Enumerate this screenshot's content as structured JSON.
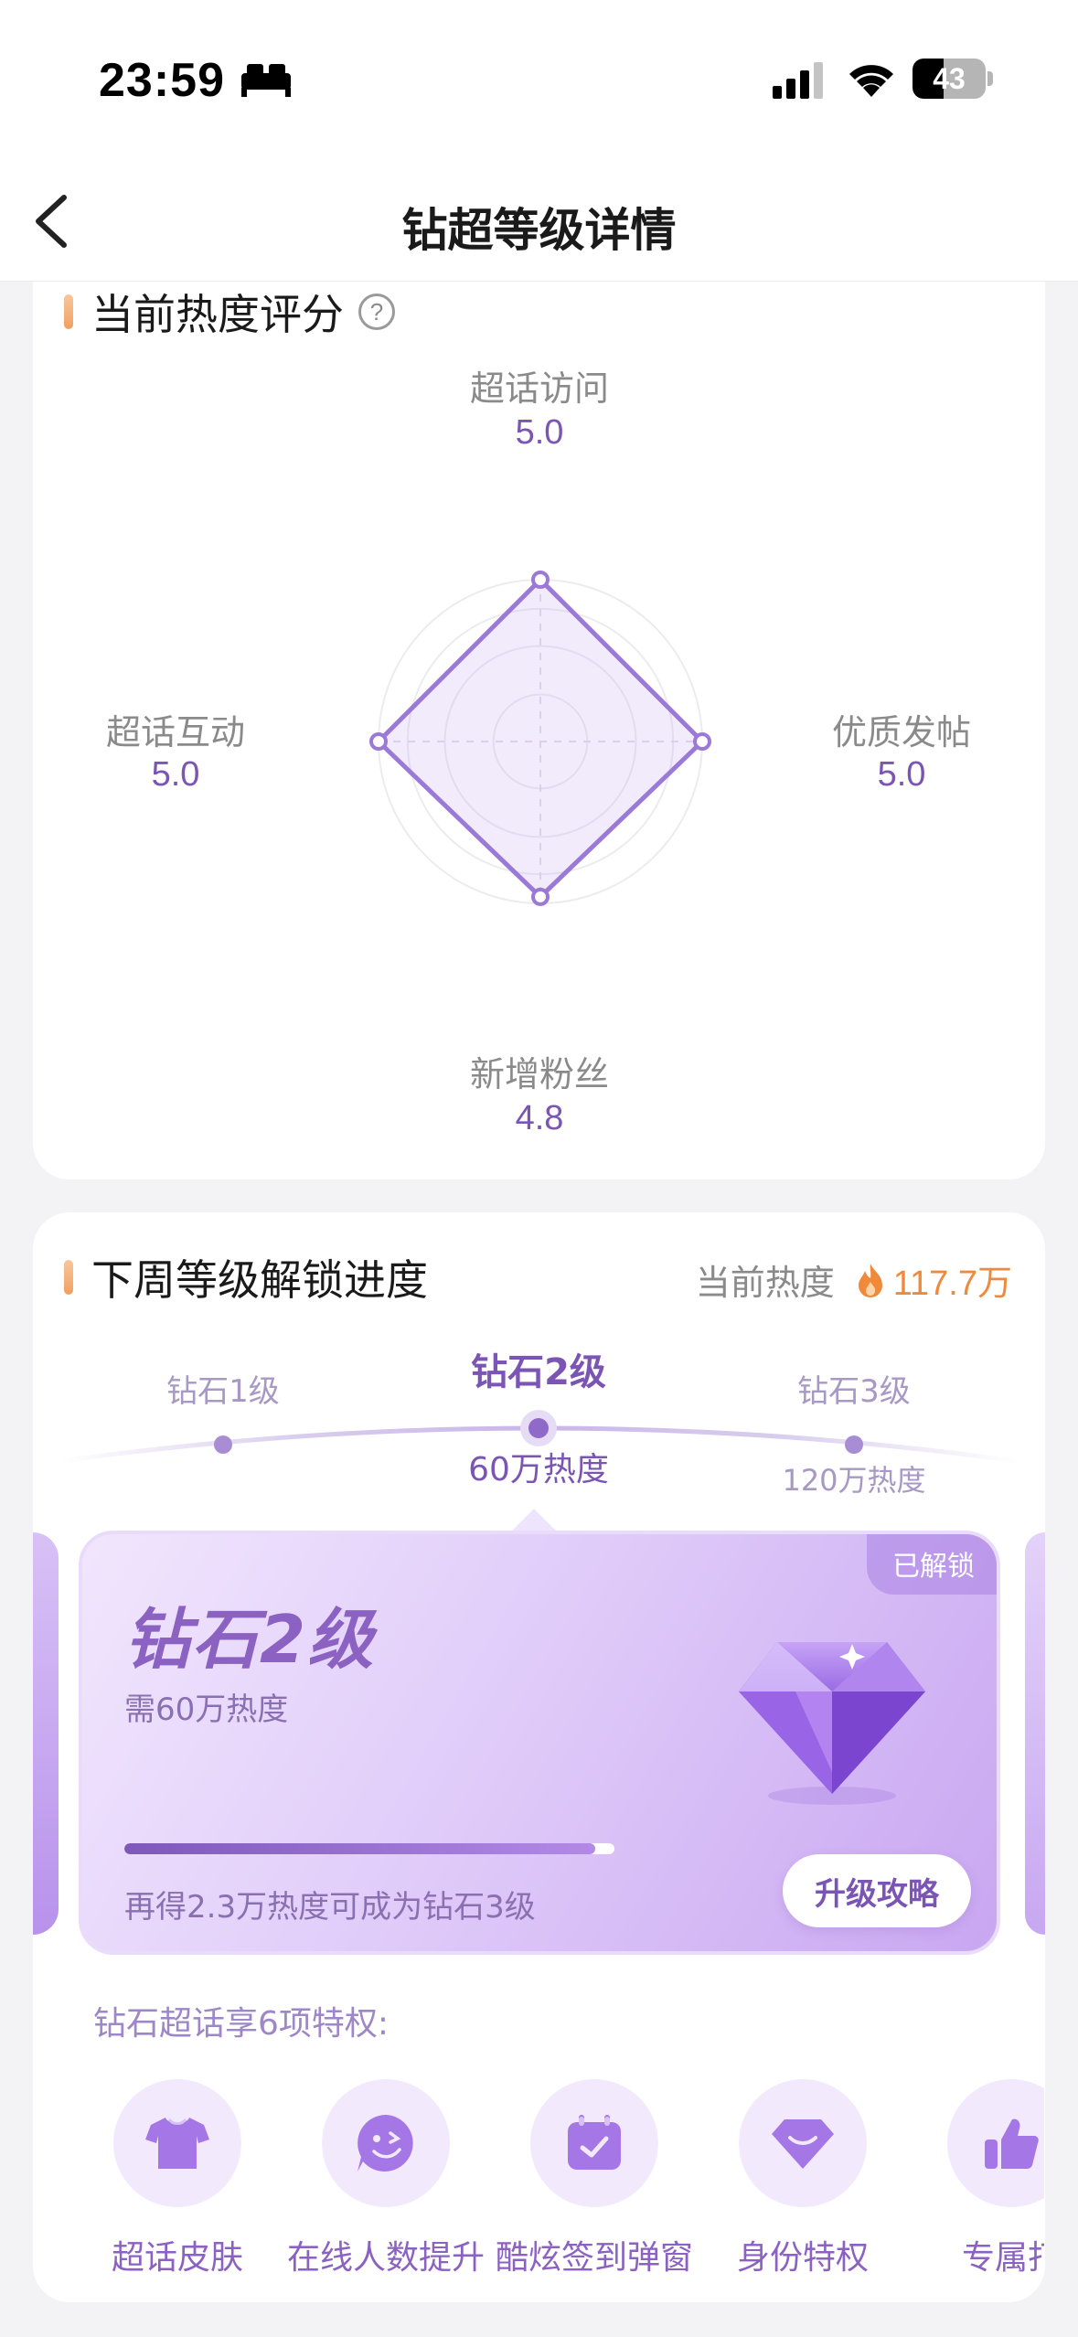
{
  "status_bar": {
    "time": "23:59",
    "battery": "43"
  },
  "nav": {
    "title": "钻超等级详情"
  },
  "score_section": {
    "title": "当前热度评分",
    "help": "?",
    "radar": [
      {
        "label": "超话访问",
        "value": "5.0",
        "score": 5.0
      },
      {
        "label": "优质发帖",
        "value": "5.0",
        "score": 5.0
      },
      {
        "label": "新增粉丝",
        "value": "4.8",
        "score": 4.8
      },
      {
        "label": "超话互动",
        "value": "5.0",
        "score": 5.0
      }
    ]
  },
  "progress_section": {
    "title": "下周等级解锁进度",
    "current_heat_label": "当前热度",
    "current_heat_value": "117.7万",
    "levels": [
      {
        "name": "钻石1级",
        "heat": ""
      },
      {
        "name": "钻石2级",
        "heat": "60万热度"
      },
      {
        "name": "钻石3级",
        "heat": "120万热度"
      }
    ],
    "card": {
      "badge": "已解锁",
      "level": "钻石2级",
      "need": "需60万热度",
      "progress": 0.96,
      "tip": "再得2.3万热度可成为钻石3级",
      "button": "升级攻略"
    },
    "perks_title": "钻石超话享6项特权:",
    "perks": [
      {
        "label": "超话皮肤",
        "icon": "tshirt-icon"
      },
      {
        "label": "在线人数提升",
        "icon": "smile-chat-icon"
      },
      {
        "label": "酷炫签到弹窗",
        "icon": "calendar-check-icon"
      },
      {
        "label": "身份特权",
        "icon": "gem-badge-icon"
      },
      {
        "label": "专属打",
        "icon": "thumbs-up-icon"
      }
    ]
  },
  "colors": {
    "accent_purple": "#7a55b3",
    "heat_orange": "#ef8a3c",
    "page_bg": "#f3f3f5"
  }
}
